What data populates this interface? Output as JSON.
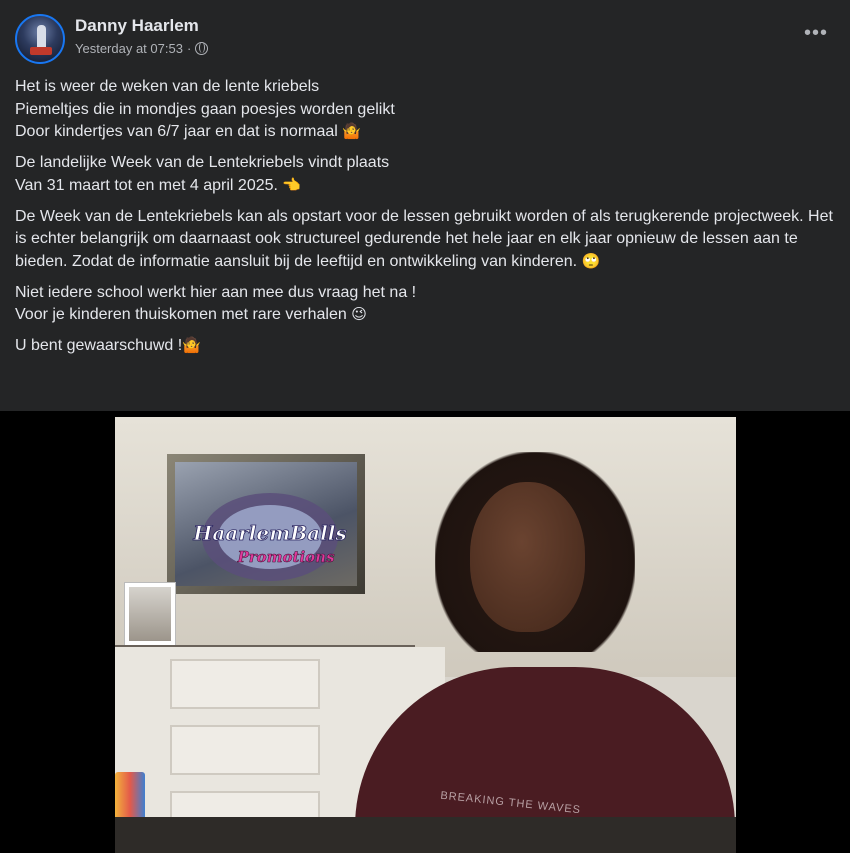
{
  "author": {
    "name": "Danny Haarlem",
    "timestamp": "Yesterday at 07:53",
    "separator": "·",
    "privacy_icon": "globe-icon"
  },
  "menu_icon": "more-horizontal-icon",
  "more_label": "•••",
  "post": {
    "p1_l1": "Het is weer de weken van de lente kriebels",
    "p1_l2": "Piemeltjes die in mondjes gaan poesjes worden gelikt",
    "p1_l3": "Door kindertjes van 6/7 jaar en dat is normaal",
    "p1_emoji": "🤷",
    "p2_l1": "De landelijke Week van de Lentekriebels vindt plaats",
    "p2_l2": "Van 31 maart tot en met 4 april 2025.",
    "p2_emoji": "👈",
    "p3": "De Week van de Lentekriebels kan als opstart voor de lessen gebruikt worden of als terugkerende projectweek. Het is echter belangrijk om daarnaast ook structureel gedurende het hele jaar en elk jaar opnieuw de lessen aan te bieden. Zodat de informatie aansluit bij de leeftijd en ontwikkeling van kinderen.",
    "p3_emoji": "🙄",
    "p4_l1": "Niet iedere school werkt hier aan mee dus vraag het na !",
    "p4_l2": "Voor je kinderen thuiskomen met rare verhalen",
    "p4_emoji": "😉",
    "p5": "U bent gewaarschuwd !",
    "p5_emoji": "🤷"
  },
  "video": {
    "logo_line1": "HaarlemBalls",
    "logo_line2": "Promotions",
    "shirt_text": "BREAKING THE WAVES"
  }
}
